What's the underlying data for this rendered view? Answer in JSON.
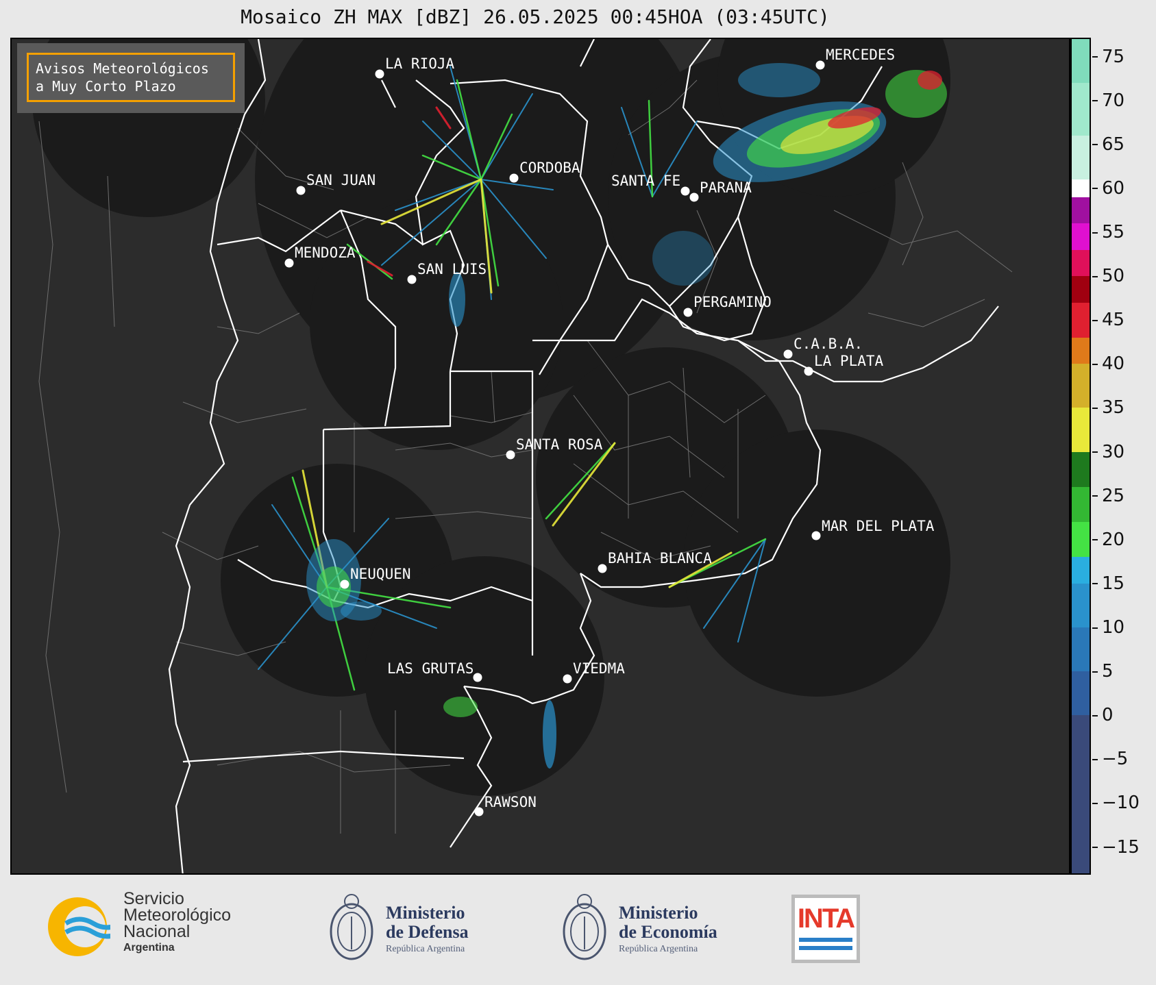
{
  "title": "Mosaico ZH MAX [dBZ] 26.05.2025 00:45HOA (03:45UTC)",
  "warning_box": {
    "line1": "Avisos Meteorológicos",
    "line2": "a Muy Corto Plazo",
    "border_color": "#f5a000"
  },
  "cities": [
    {
      "name": "LA RIOJA"
    },
    {
      "name": "MERCEDES"
    },
    {
      "name": "CORDOBA"
    },
    {
      "name": "SAN JUAN"
    },
    {
      "name": "SANTA FE"
    },
    {
      "name": "PARANA"
    },
    {
      "name": "MENDOZA"
    },
    {
      "name": "SAN LUIS"
    },
    {
      "name": "PERGAMINO"
    },
    {
      "name": "C.A.B.A."
    },
    {
      "name": "LA PLATA"
    },
    {
      "name": "SANTA ROSA"
    },
    {
      "name": "MAR DEL PLATA"
    },
    {
      "name": "BAHIA BLANCA"
    },
    {
      "name": "NEUQUEN"
    },
    {
      "name": "LAS GRUTAS"
    },
    {
      "name": "VIEDMA"
    },
    {
      "name": "RAWSON"
    }
  ],
  "colorbar": {
    "unit": "dBZ",
    "min": -18,
    "max": 77,
    "ticks": [
      "75",
      "70",
      "65",
      "60",
      "55",
      "50",
      "45",
      "40",
      "35",
      "30",
      "25",
      "20",
      "15",
      "10",
      "5",
      "0",
      "−5",
      "−10",
      "−15"
    ],
    "tick_values": [
      75,
      70,
      65,
      60,
      55,
      50,
      45,
      40,
      35,
      30,
      25,
      20,
      15,
      10,
      5,
      0,
      -5,
      -10,
      -15
    ],
    "stops": [
      {
        "from": -18,
        "to": 0,
        "color": "#3a4a7a"
      },
      {
        "from": 0,
        "to": 5,
        "color": "#2f5fa0"
      },
      {
        "from": 5,
        "to": 10,
        "color": "#2a78b8"
      },
      {
        "from": 10,
        "to": 15,
        "color": "#2a92cc"
      },
      {
        "from": 15,
        "to": 18,
        "color": "#2aaee0"
      },
      {
        "from": 18,
        "to": 22,
        "color": "#44e244"
      },
      {
        "from": 22,
        "to": 26,
        "color": "#33b833"
      },
      {
        "from": 26,
        "to": 30,
        "color": "#1e7a1e"
      },
      {
        "from": 30,
        "to": 35,
        "color": "#e8e83a"
      },
      {
        "from": 35,
        "to": 40,
        "color": "#d4b02a"
      },
      {
        "from": 40,
        "to": 43,
        "color": "#e07a1a"
      },
      {
        "from": 43,
        "to": 47,
        "color": "#e02030"
      },
      {
        "from": 47,
        "to": 50,
        "color": "#a00010"
      },
      {
        "from": 50,
        "to": 53,
        "color": "#e0105a"
      },
      {
        "from": 53,
        "to": 56,
        "color": "#e010d0"
      },
      {
        "from": 56,
        "to": 59,
        "color": "#a010a0"
      },
      {
        "from": 59,
        "to": 61,
        "color": "#ffffff"
      },
      {
        "from": 61,
        "to": 66,
        "color": "#c8f0e0"
      },
      {
        "from": 66,
        "to": 72,
        "color": "#a0e8cc"
      },
      {
        "from": 72,
        "to": 77,
        "color": "#80dcbc"
      }
    ]
  },
  "logos": {
    "smn": {
      "line1": "Servicio",
      "line2": "Meteorológico",
      "line3": "Nacional",
      "line4": "Argentina"
    },
    "defensa": {
      "line1": "Ministerio",
      "line2": "de Defensa",
      "line3": "República Argentina"
    },
    "economia": {
      "line1": "Ministerio",
      "line2": "de Economía",
      "line3": "República Argentina"
    },
    "inta": {
      "label": "INTA"
    }
  },
  "colors": {
    "map_background": "#2c2c2c",
    "radar_coverage": "#1b1b1b",
    "borders": "#ffffff",
    "departments": "#777777"
  }
}
